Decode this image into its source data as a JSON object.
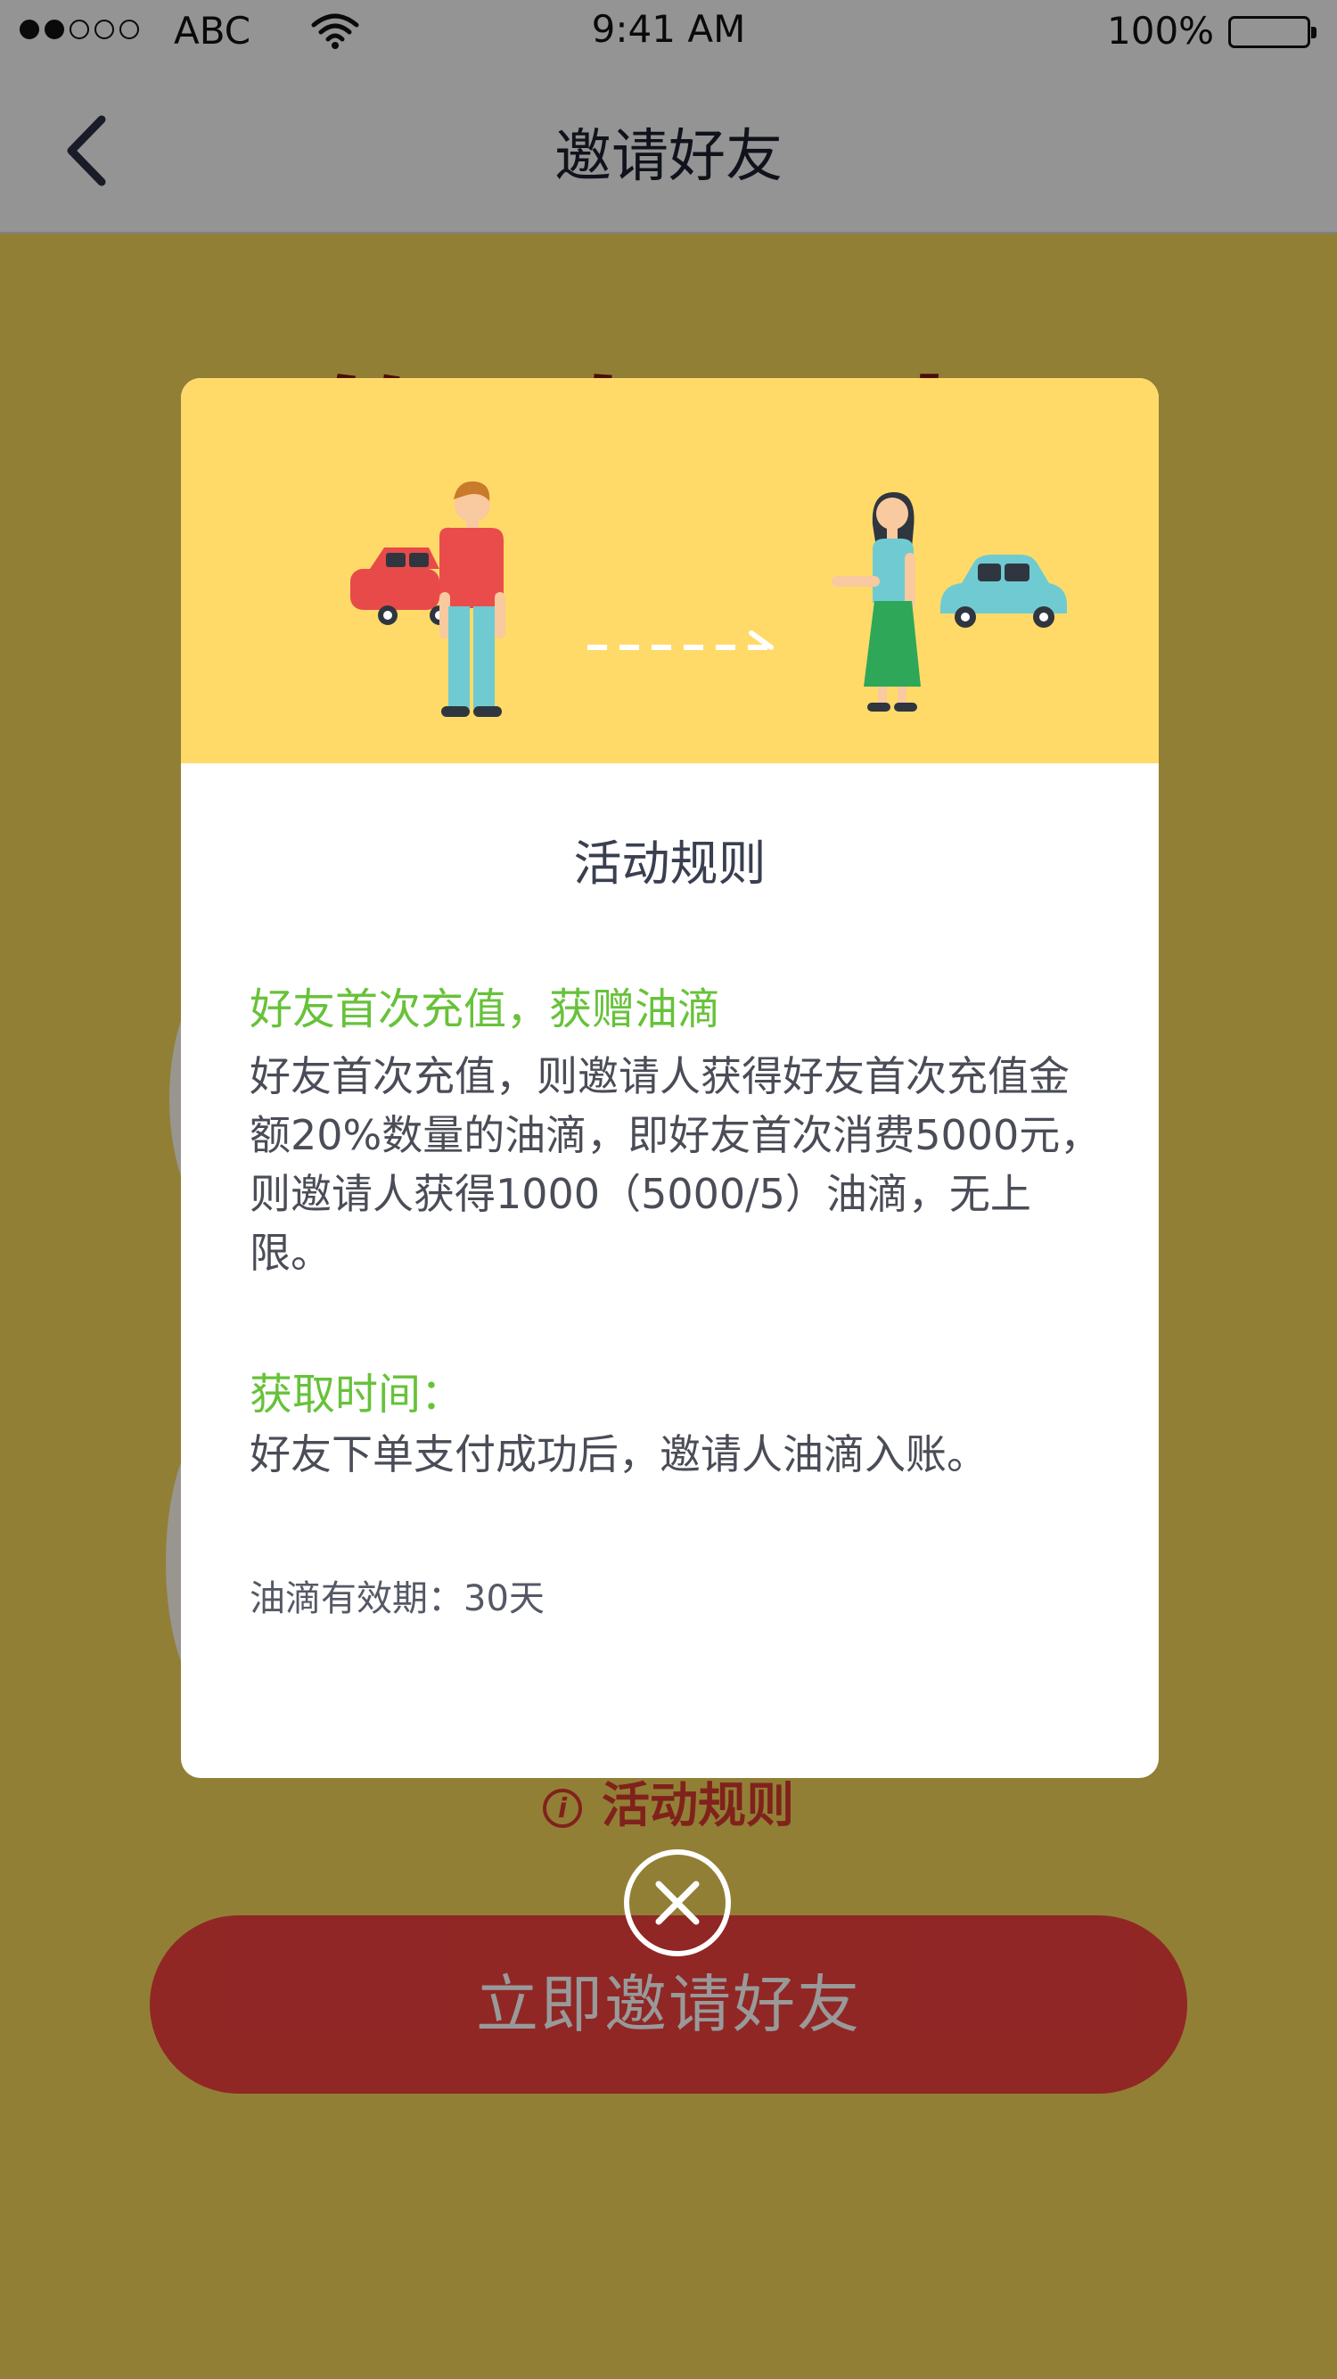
{
  "status_bar": {
    "carrier": "ABC",
    "time": "9:41 AM",
    "battery": "100%",
    "signal_icon": "signal-dots-icon",
    "wifi_icon": "wifi-icon",
    "battery_icon": "battery-full-icon"
  },
  "nav": {
    "title": "邀请好友",
    "back_icon": "chevron-left-icon"
  },
  "background": {
    "heading": "邀 好 友",
    "rules_link": "活动规则",
    "rules_icon": "info-circle-icon",
    "invite_button": "立即邀请好友"
  },
  "modal": {
    "title": "活动规则",
    "sections": [
      {
        "heading": "好友首次充值，获赠油滴",
        "body": "好友首次充值，则邀请人获得好友首次充值金额20%数量的油滴，即好友首次消费5000元，则邀请人获得1000（5000/5）油滴，无上限。"
      },
      {
        "heading": "获取时间：",
        "body": "好友下单支付成功后，邀请人油滴入账。"
      }
    ],
    "validity": "油滴有效期：30天",
    "close_icon": "close-circle-icon"
  },
  "colors": {
    "banner": "#ffda69",
    "section_heading": "#67c23a",
    "invite_button": "#f0413f",
    "page_background": "#f3d45a"
  }
}
